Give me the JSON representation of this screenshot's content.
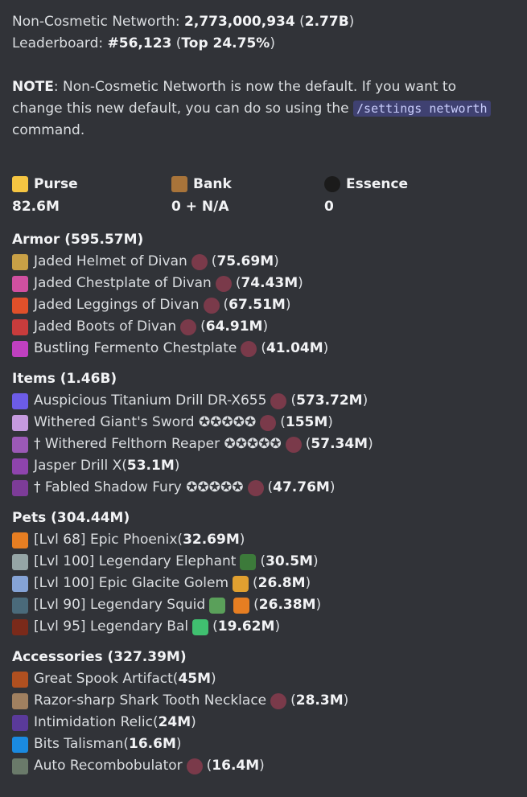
{
  "networth_line": {
    "label": "Non-Cosmetic Networth: ",
    "value": "2,773,000,934",
    "short": "2.77B"
  },
  "leaderboard_line": {
    "label": "Leaderboard: ",
    "rank": "#56,123",
    "top": "Top 24.75%"
  },
  "note": {
    "label": "NOTE",
    "text1": ": Non-Cosmetic Networth is now the default. If you want to change this new default, you can do so using the ",
    "cmd": "/settings networth",
    "text2": " command."
  },
  "stats": [
    {
      "label": "Purse",
      "value": "82.6M",
      "icon": "gold-ingot-icon",
      "color": "#f5c542"
    },
    {
      "label": "Bank",
      "value": "0 + N/A",
      "icon": "chest-icon",
      "color": "#a8743a"
    },
    {
      "label": "Essence",
      "value": "0",
      "icon": "essence-icon",
      "color": "#1b1b1b"
    }
  ],
  "sections": [
    {
      "title": "Armor (595.57M)",
      "items": [
        {
          "name": "Jaded Helmet of Divan",
          "value": "75.69M",
          "icon": "helmet-icon",
          "color": "#c8a046",
          "gem": true
        },
        {
          "name": "Jaded Chestplate of Divan",
          "value": "74.43M",
          "icon": "chestplate-icon",
          "color": "#d050a0",
          "gem": true
        },
        {
          "name": "Jaded Leggings of Divan",
          "value": "67.51M",
          "icon": "leggings-icon",
          "color": "#e0502a",
          "gem": true
        },
        {
          "name": "Jaded Boots of Divan",
          "value": "64.91M",
          "icon": "boots-icon",
          "color": "#c83c3c",
          "gem": true
        },
        {
          "name": "Bustling Fermento Chestplate",
          "value": "41.04M",
          "icon": "fermento-chestplate-icon",
          "color": "#c040c0",
          "gem": true
        }
      ]
    },
    {
      "title": "Items (1.46B)",
      "items": [
        {
          "name": "Auspicious Titanium Drill DR-X655",
          "value": "573.72M",
          "icon": "drill-icon",
          "color": "#6c5ce7",
          "gem": true
        },
        {
          "name": "Withered Giant's Sword ✪✪✪✪✪",
          "value": "155M",
          "icon": "sword-icon",
          "color": "#c59ade",
          "gem": true
        },
        {
          "name": "† Withered Felthorn Reaper ✪✪✪✪✪",
          "value": "57.34M",
          "icon": "reaper-icon",
          "color": "#9b59b6",
          "gem": true
        },
        {
          "name": "Jasper Drill X",
          "value": "53.1M",
          "icon": "jasper-drill-icon",
          "color": "#8e44ad",
          "gem": false
        },
        {
          "name": "† Fabled Shadow Fury ✪✪✪✪✪",
          "value": "47.76M",
          "icon": "shadow-fury-icon",
          "color": "#7d3c98",
          "gem": true
        }
      ]
    },
    {
      "title": "Pets (304.44M)",
      "items": [
        {
          "name": "[Lvl 68] Epic Phoenix",
          "value": "32.69M",
          "icon": "phoenix-icon",
          "color": "#e67e22",
          "extra": []
        },
        {
          "name": "[Lvl 100] Legendary Elephant",
          "value": "30.5M",
          "icon": "elephant-icon",
          "color": "#95a5a6",
          "extra": [
            {
              "icon": "leaf-icon",
              "color": "#3c7a3a"
            }
          ]
        },
        {
          "name": "[Lvl 100] Epic Glacite Golem",
          "value": "26.8M",
          "icon": "golem-icon",
          "color": "#85a3d6",
          "extra": [
            {
              "icon": "sponge-icon",
              "color": "#e0a030"
            }
          ]
        },
        {
          "name": "[Lvl 90] Legendary Squid",
          "value": "26.38M",
          "icon": "squid-icon",
          "color": "#4a6a7a",
          "extra": [
            {
              "icon": "zombie-icon",
              "color": "#5aa05a"
            },
            {
              "icon": "carrot-icon",
              "color": "#e67e22"
            }
          ]
        },
        {
          "name": "[Lvl 95] Legendary Bal",
          "value": "19.62M",
          "icon": "bal-icon",
          "color": "#7a2a1a",
          "extra": [
            {
              "icon": "clover-icon",
              "color": "#40c070"
            }
          ]
        }
      ]
    },
    {
      "title": "Accessories (327.39M)",
      "items": [
        {
          "name": "Great Spook Artifact",
          "value": "45M",
          "icon": "spook-icon",
          "color": "#b05020",
          "gem": false
        },
        {
          "name": "Razor-sharp Shark Tooth Necklace",
          "value": "28.3M",
          "icon": "necklace-icon",
          "color": "#a08060",
          "gem": true
        },
        {
          "name": "Intimidation Relic",
          "value": "24M",
          "icon": "relic-icon",
          "color": "#5a3a9a",
          "gem": false
        },
        {
          "name": "Bits Talisman",
          "value": "16.6M",
          "icon": "bits-icon",
          "color": "#1a8ae0",
          "gem": false
        },
        {
          "name": "Auto Recombobulator",
          "value": "16.4M",
          "icon": "recombobulator-icon",
          "color": "#6a7a6a",
          "gem": true
        }
      ]
    }
  ],
  "gem_icon": {
    "name": "gemstone-icon",
    "color": "#7a3a4a"
  }
}
